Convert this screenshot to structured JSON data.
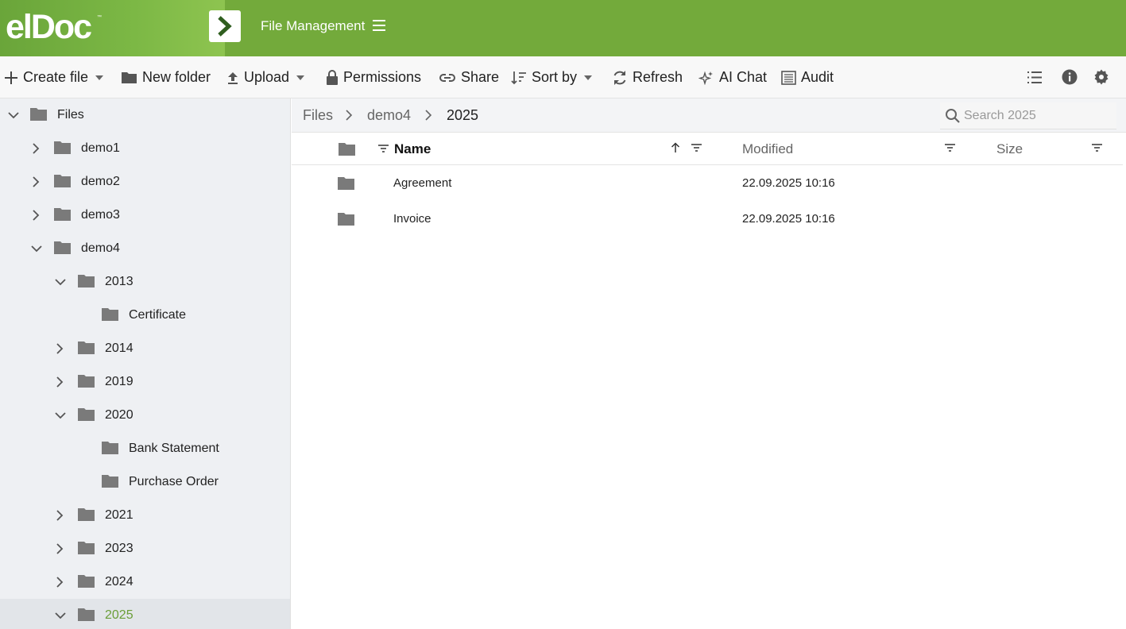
{
  "header": {
    "logo": "elDoc",
    "logo_tm": "™",
    "app_title": "File Management"
  },
  "toolbar": {
    "create_file": "Create file",
    "new_folder": "New folder",
    "upload": "Upload",
    "permissions": "Permissions",
    "share": "Share",
    "sort_by": "Sort by",
    "refresh": "Refresh",
    "ai_chat": "AI Chat",
    "audit": "Audit"
  },
  "tree": {
    "root": "Files",
    "demo1": "demo1",
    "demo2": "demo2",
    "demo3": "demo3",
    "demo4": "demo4",
    "y2013": "2013",
    "certificate": "Certificate",
    "y2014": "2014",
    "y2019": "2019",
    "y2020": "2020",
    "bank_statement": "Bank Statement",
    "purchase_order": "Purchase Order",
    "y2021": "2021",
    "y2023": "2023",
    "y2024": "2024",
    "y2025": "2025"
  },
  "breadcrumb": [
    "Files",
    "demo4",
    "2025"
  ],
  "search": {
    "placeholder": "Search 2025"
  },
  "grid": {
    "columns": {
      "name": "Name",
      "modified": "Modified",
      "size": "Size"
    },
    "rows": [
      {
        "name": "Agreement",
        "modified": "22.09.2025 10:16",
        "size": ""
      },
      {
        "name": "Invoice",
        "modified": "22.09.2025 10:16",
        "size": ""
      }
    ]
  },
  "colors": {
    "brand_green": "#73aa3b",
    "selected_text": "#6a9e38"
  }
}
